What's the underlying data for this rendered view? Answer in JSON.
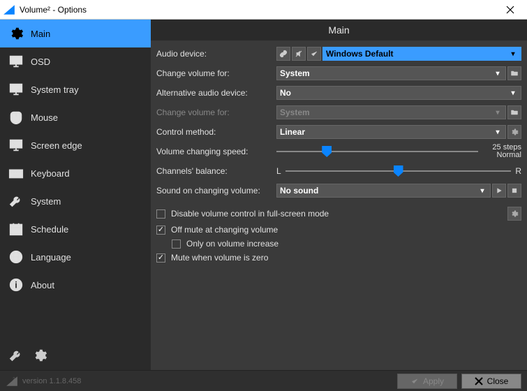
{
  "window": {
    "title": "Volume² - Options"
  },
  "sidebar": {
    "items": [
      {
        "label": "Main"
      },
      {
        "label": "OSD"
      },
      {
        "label": "System tray"
      },
      {
        "label": "Mouse"
      },
      {
        "label": "Screen edge"
      },
      {
        "label": "Keyboard"
      },
      {
        "label": "System"
      },
      {
        "label": "Schedule"
      },
      {
        "label": "Language"
      },
      {
        "label": "About"
      }
    ]
  },
  "content": {
    "heading": "Main",
    "labels": {
      "audio_device": "Audio device:",
      "change_volume_for": "Change volume for:",
      "alt_audio_device": "Alternative audio device:",
      "change_volume_for2": "Change volume for:",
      "control_method": "Control method:",
      "volume_speed": "Volume changing speed:",
      "channels_balance": "Channels' balance:",
      "sound_on_change": "Sound on changing volume:"
    },
    "values": {
      "audio_device": "Windows Default",
      "change_volume_for": "System",
      "alt_audio_device": "No",
      "change_volume_for2": "System",
      "control_method": "Linear",
      "sound_on_change": "No sound",
      "speed_steps": "25 steps",
      "speed_mode": "Normal",
      "balance_left": "L",
      "balance_right": "R"
    },
    "checkboxes": {
      "disable_fullscreen": "Disable volume control in full-screen mode",
      "off_mute": "Off mute at changing volume",
      "only_increase": "Only on volume increase",
      "mute_zero": "Mute when volume is zero"
    }
  },
  "footer": {
    "version": "version 1.1.8.458",
    "apply": "Apply",
    "close": "Close"
  }
}
